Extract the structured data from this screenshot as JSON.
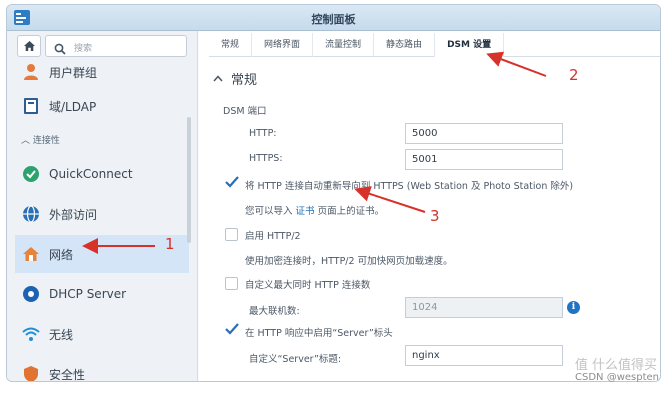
{
  "window": {
    "title": "控制面板"
  },
  "sidebar": {
    "search_placeholder": "搜索",
    "items": [
      {
        "label": "用户群组",
        "icon": "user-group-icon"
      },
      {
        "label": "域/LDAP",
        "icon": "domain-ldap-icon"
      },
      {
        "label": "QuickConnect",
        "icon": "quickconnect-icon"
      },
      {
        "label": "外部访问",
        "icon": "external-access-icon"
      },
      {
        "label": "网络",
        "icon": "network-icon",
        "active": true
      },
      {
        "label": "DHCP Server",
        "icon": "dhcp-server-icon"
      },
      {
        "label": "无线",
        "icon": "wireless-icon"
      },
      {
        "label": "安全性",
        "icon": "security-icon"
      }
    ],
    "section_label": "连接性"
  },
  "tabs": [
    {
      "label": "常规"
    },
    {
      "label": "网络界面"
    },
    {
      "label": "流量控制"
    },
    {
      "label": "静态路由"
    },
    {
      "label": "DSM 设置",
      "active": true
    }
  ],
  "main": {
    "section_title": "常规",
    "dsm_port_label": "DSM 端口",
    "http_label": "HTTP:",
    "http_value": "5000",
    "https_label": "HTTPS:",
    "https_value": "5001",
    "redirect_checkbox": {
      "label": "将 HTTP 连接自动重新导向到 HTTPS (Web Station 及 Photo Station 除外)",
      "checked": true
    },
    "cert_hint_before": "您可以导入",
    "cert_hint_link": "证书",
    "cert_hint_after": "页面上的证书。",
    "http2_checkbox": {
      "label": "启用 HTTP/2",
      "checked": false
    },
    "http2_hint": "使用加密连接时，HTTP/2 可加快网页加载速度。",
    "max_conn_checkbox": {
      "label": "自定义最大同时 HTTP 连接数",
      "checked": false
    },
    "max_conn_label": "最大联机数:",
    "max_conn_value": "1024",
    "server_header_checkbox": {
      "label": "在 HTTP 响应中启用“Server”标头",
      "checked": true
    },
    "server_header_label": "自定义“Server”标题:",
    "server_header_value": "nginx"
  },
  "annotations": {
    "n1": "1",
    "n2": "2",
    "n3": "3",
    "color": "#d6322a"
  },
  "watermark": {
    "site": "值 什么值得买",
    "author": "CSDN @wespten"
  },
  "colors": {
    "accent": "#1f74c5",
    "active_nav_bg": "#d3e5f6",
    "titlebar": "#c6dbec"
  }
}
